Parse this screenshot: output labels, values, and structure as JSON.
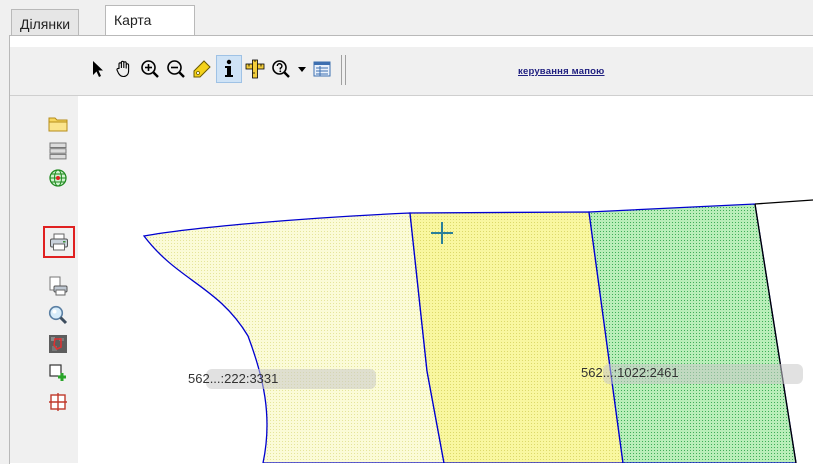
{
  "tabs": [
    {
      "label": "Ділянки",
      "active": false
    },
    {
      "label": "Карта",
      "active": true
    }
  ],
  "toolbar": {
    "tools": [
      {
        "icon": "arrow-pointer-icon",
        "active": false
      },
      {
        "icon": "pan-hand-icon",
        "active": false
      },
      {
        "icon": "zoom-in-icon",
        "active": false
      },
      {
        "icon": "zoom-out-icon",
        "active": false
      },
      {
        "icon": "tag-icon",
        "active": false
      },
      {
        "icon": "info-icon",
        "active": true
      },
      {
        "icon": "measure-ruler-icon",
        "active": false
      },
      {
        "icon": "query-icon",
        "active": false
      },
      {
        "icon": "dropdown-arrow-icon",
        "active": false
      },
      {
        "icon": "legend-table-icon",
        "active": false
      }
    ],
    "link_label": "керування мапою"
  },
  "sidebar": {
    "items": [
      {
        "icon": "folder-icon",
        "highlighted": false
      },
      {
        "icon": "layers-icon",
        "highlighted": false
      },
      {
        "icon": "globe-icon",
        "highlighted": false
      },
      {
        "icon": "print-icon",
        "highlighted": true
      },
      {
        "icon": "print-preview-icon",
        "highlighted": false
      },
      {
        "icon": "search-magnifier-icon",
        "highlighted": false
      },
      {
        "icon": "raster-map-icon",
        "highlighted": false
      },
      {
        "icon": "add-feature-icon",
        "highlighted": false
      },
      {
        "icon": "crosshair-icon",
        "highlighted": false
      }
    ]
  },
  "map": {
    "parcels": [
      {
        "label": "562...:222:3331",
        "fill": "#fbfbd7"
      },
      {
        "label": "",
        "fill": "#f9f7a0"
      },
      {
        "label": "562...:1022:2461",
        "fill": "#b9eeb9"
      }
    ],
    "boundary_color": "#0000d0"
  }
}
